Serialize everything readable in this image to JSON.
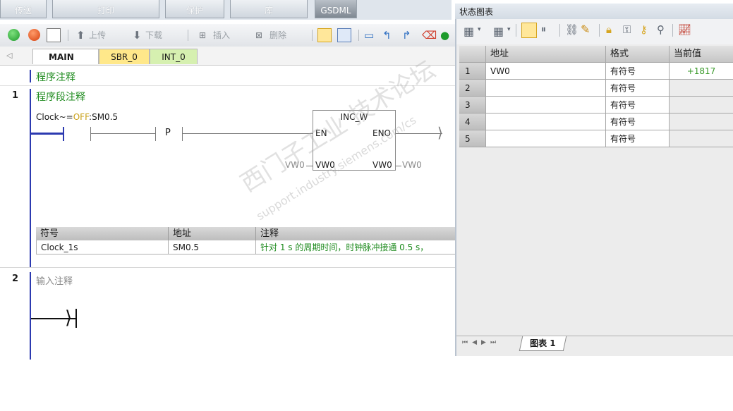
{
  "ribbon": {
    "buttons": [
      "传送",
      "打印",
      "保护",
      "库",
      "GSDML"
    ]
  },
  "toolbar": {
    "upload_label": "上传",
    "download_label": "下载",
    "insert_label": "插入",
    "delete_label": "删除"
  },
  "tabs": [
    {
      "label": "MAIN",
      "close": "×"
    },
    {
      "label": "SBR_0"
    },
    {
      "label": "INT_0"
    }
  ],
  "editor": {
    "program_comment": "程序注释",
    "networks": [
      {
        "number": "1",
        "comment": "程序段注释",
        "contact_label": "Clock~=OFF:SM0.5",
        "contact_prefix": "Clock~=",
        "contact_state": "OFF",
        "contact_addr": ":SM0.5",
        "p_label": "P",
        "box": {
          "title": "INC_W",
          "en": "EN",
          "eno": "ENO",
          "in": "VW0",
          "out": "VW0"
        },
        "in_value": "VW0",
        "out_value": "VW0",
        "symbol_table": {
          "headers": [
            "符号",
            "地址",
            "注释"
          ],
          "rows": [
            [
              "Clock_1s",
              "SM0.5",
              "针对 1 s 的周期时间，时钟脉冲接通 0.5 s，"
            ]
          ]
        }
      },
      {
        "number": "2",
        "comment": "输入注释"
      }
    ]
  },
  "status_chart": {
    "title": "状态图表",
    "headers": [
      "地址",
      "格式",
      "当前值"
    ],
    "rows": [
      {
        "n": "1",
        "address": "VW0",
        "format": "有符号",
        "value": "+1817"
      },
      {
        "n": "2",
        "address": "",
        "format": "有符号",
        "value": ""
      },
      {
        "n": "3",
        "address": "",
        "format": "有符号",
        "value": ""
      },
      {
        "n": "4",
        "address": "",
        "format": "有符号",
        "value": ""
      },
      {
        "n": "5",
        "address": "",
        "format": "有符号",
        "value": ""
      }
    ],
    "sheet_tab": "图表 1"
  },
  "watermark": {
    "line1": "西门子工业 技术论坛",
    "line2": "support.industry.siemens.com/cs"
  },
  "colors": {
    "comment_green": "#1e8b1e",
    "rail_blue": "#2c3ab0",
    "value_green": "#3a9a2a",
    "tab_yellow": "#ffe88a",
    "tab_green": "#d6f0b0"
  }
}
